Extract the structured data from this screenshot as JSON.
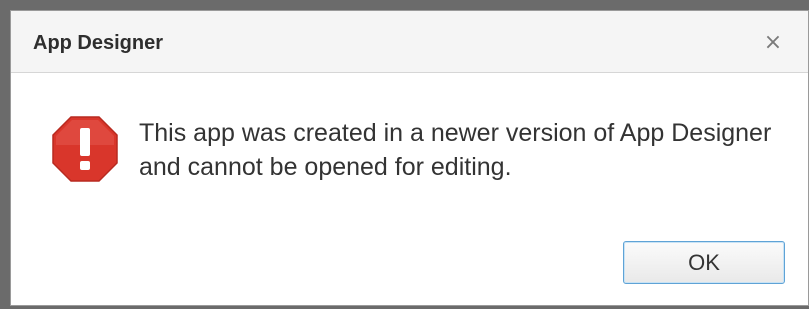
{
  "dialog": {
    "title": "App Designer",
    "close_symbol": "×",
    "icon": "error-octagon-icon",
    "message": "This app was created in a newer version of App Designer and cannot be opened for editing.",
    "ok_label": "OK"
  },
  "colors": {
    "error_red": "#d9362b",
    "button_border": "#5fa3d6",
    "backdrop": "#6b6b6b"
  }
}
